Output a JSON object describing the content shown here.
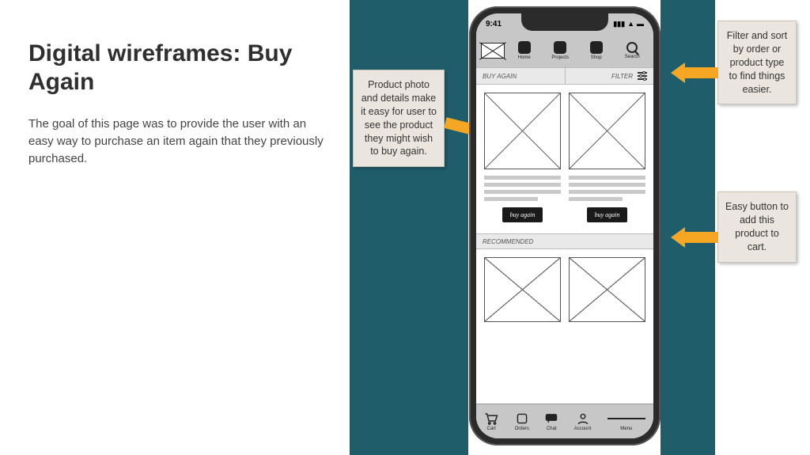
{
  "slide": {
    "title": "Digital wireframes: Buy Again",
    "body": "The goal of this page was to provide the user with an easy way to purchase an item again that they previously purchased."
  },
  "annotations": {
    "product": "Product photo and details make it easy for user to see the product they might wish to buy again.",
    "filter": "Filter and sort by order or product type to find things easier.",
    "button": "Easy button to add this product to cart."
  },
  "phone": {
    "status_time": "9:41",
    "topnav": {
      "home": "Home",
      "projects": "Projects",
      "shop": "Shop",
      "search": "Search"
    },
    "section": {
      "buy_again": "BUY AGAIN",
      "filter": "FILTER"
    },
    "buy_button": "buy again",
    "recommended": "RECOMMENDED",
    "bottomnav": {
      "cart": "Cart",
      "orders": "Orders",
      "chat": "Chat",
      "account": "Account",
      "menu": "Menu"
    }
  }
}
